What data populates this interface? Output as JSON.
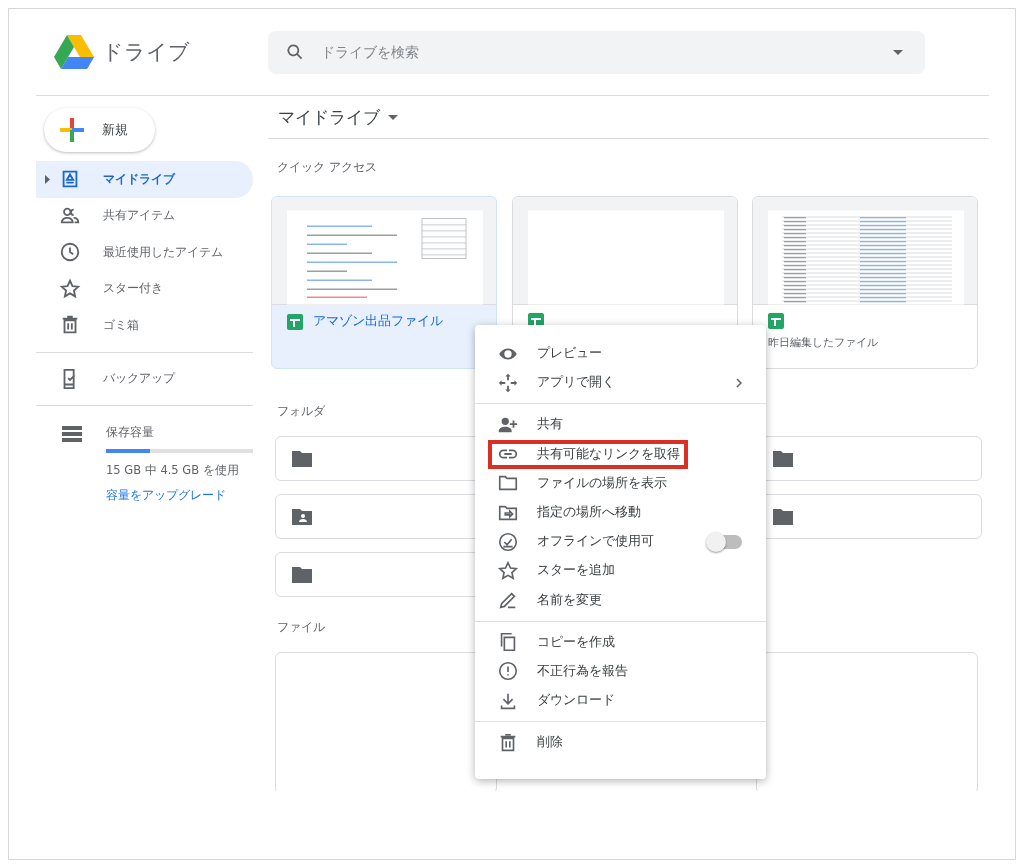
{
  "app": {
    "name": "ドライブ"
  },
  "search": {
    "placeholder": "ドライブを検索"
  },
  "new_button": {
    "label": "新規"
  },
  "sidebar": {
    "items": [
      {
        "label": "マイドライブ",
        "selected": true
      },
      {
        "label": "共有アイテム",
        "selected": false
      },
      {
        "label": "最近使用したアイテム",
        "selected": false
      },
      {
        "label": "スター付き",
        "selected": false
      },
      {
        "label": "ゴミ箱",
        "selected": false
      }
    ],
    "backup": {
      "label": "バックアップ",
      "selected": false
    },
    "storage": {
      "label": "保存容量",
      "level": 0.3,
      "usage": "15 GB 中 4.5 GB を使用",
      "upgrade_link": "容量をアップグレード"
    }
  },
  "breadcrumb": "マイドライブ",
  "quick_access": {
    "title": "クイック アクセス",
    "cards": [
      {
        "name": "アマゾン出品ファイル",
        "selected": true
      },
      {
        "selected": false
      },
      {
        "subtitle": "昨日編集したファイル",
        "selected": false
      }
    ]
  },
  "folders": {
    "title": "フォルダ",
    "items": [
      {
        "kind": "plain"
      },
      {
        "kind": "plain"
      },
      {
        "kind": "shared"
      },
      {
        "kind": "plain"
      },
      {
        "kind": "plain"
      }
    ]
  },
  "files": {
    "title": "ファイル"
  },
  "context_menu": {
    "groups": [
      [
        {
          "label": "プレビュー"
        },
        {
          "label": "アプリで開く",
          "submenu": true
        }
      ],
      [
        {
          "label": "共有"
        },
        {
          "label": "共有可能なリンクを取得",
          "highlighted": true
        },
        {
          "label": "ファイルの場所を表示"
        },
        {
          "label": "指定の場所へ移動"
        },
        {
          "label": "オフラインで使用可",
          "toggle_on": false
        },
        {
          "label": "スターを追加"
        },
        {
          "label": "名前を変更"
        }
      ],
      [
        {
          "label": "コピーを作成"
        },
        {
          "label": "不正行為を報告"
        },
        {
          "label": "ダウンロード"
        }
      ],
      [
        {
          "label": "削除"
        }
      ]
    ]
  }
}
